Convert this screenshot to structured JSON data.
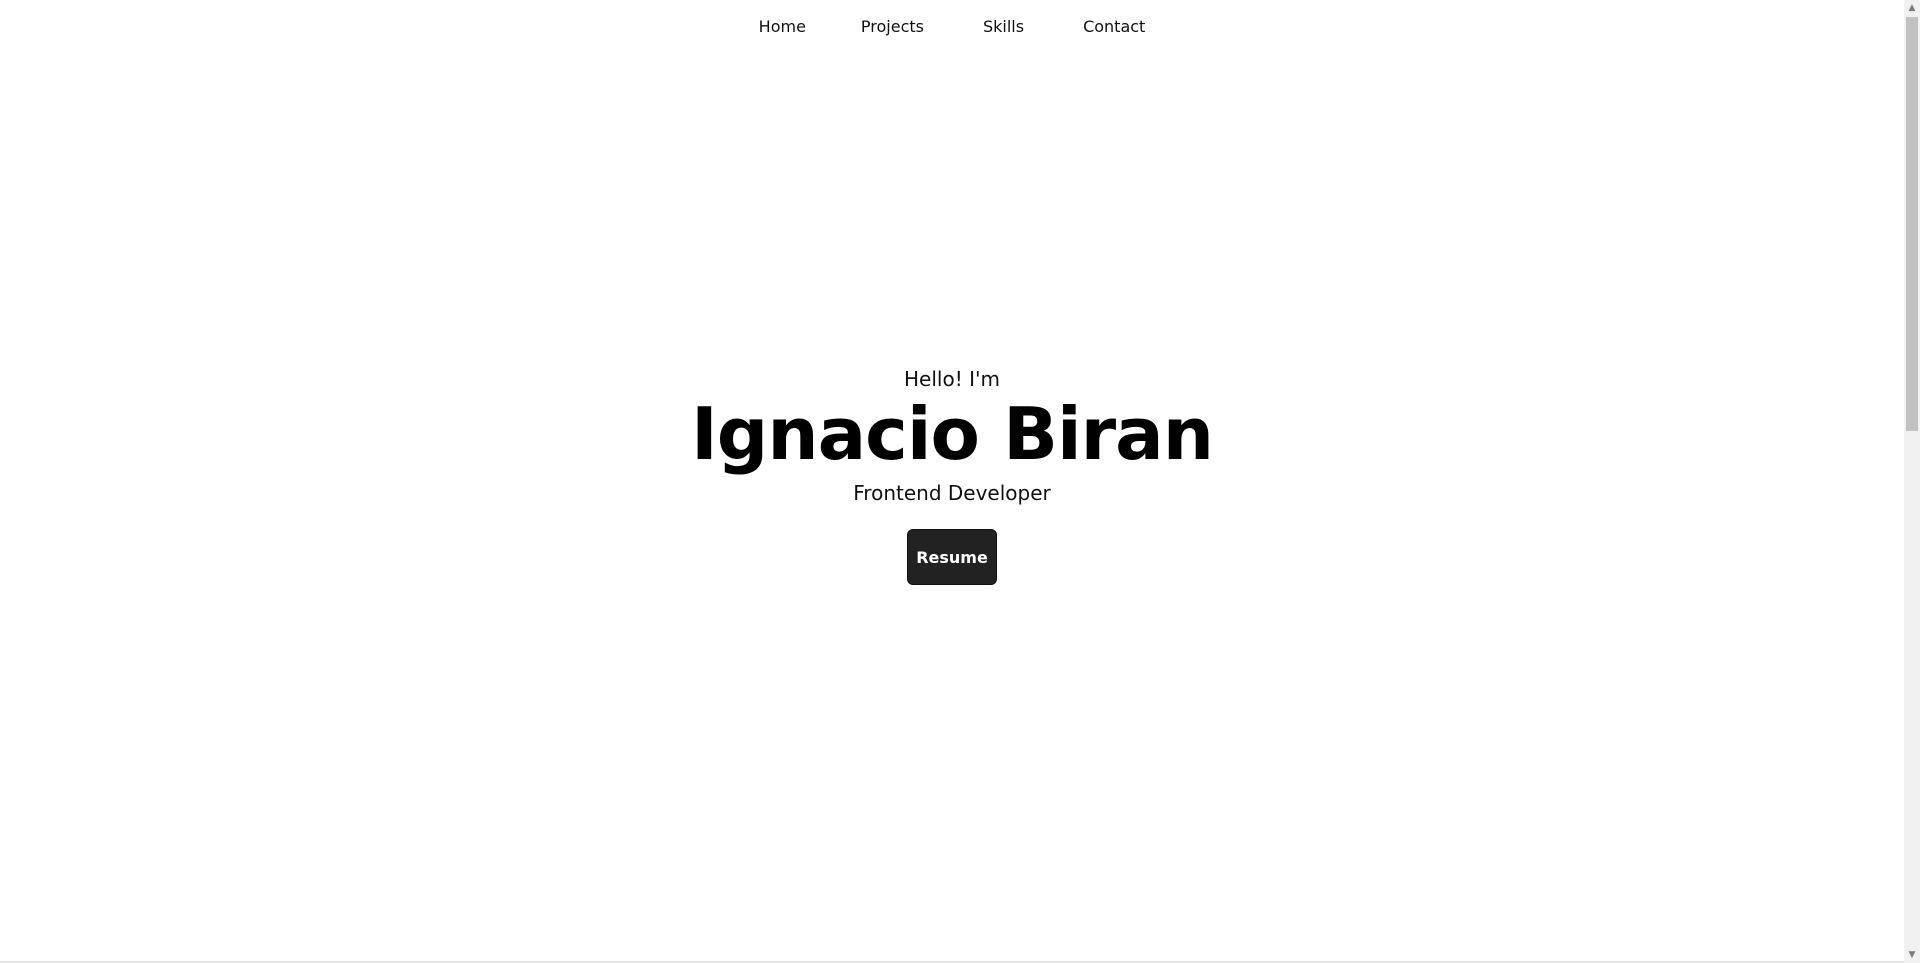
{
  "nav": {
    "items": [
      {
        "label": "Home"
      },
      {
        "label": "Projects"
      },
      {
        "label": "Skills"
      },
      {
        "label": "Contact"
      }
    ]
  },
  "hero": {
    "greeting": "Hello! I'm",
    "name": "Ignacio Biran",
    "role": "Frontend Developer",
    "resume_label": "Resume"
  },
  "colors": {
    "background": "#ffffff",
    "text": "#000000",
    "button_bg": "#222222",
    "button_text": "#ffffff"
  },
  "icons": {
    "scroll_up": "triangle-up-icon",
    "scroll_down": "triangle-down-icon"
  }
}
